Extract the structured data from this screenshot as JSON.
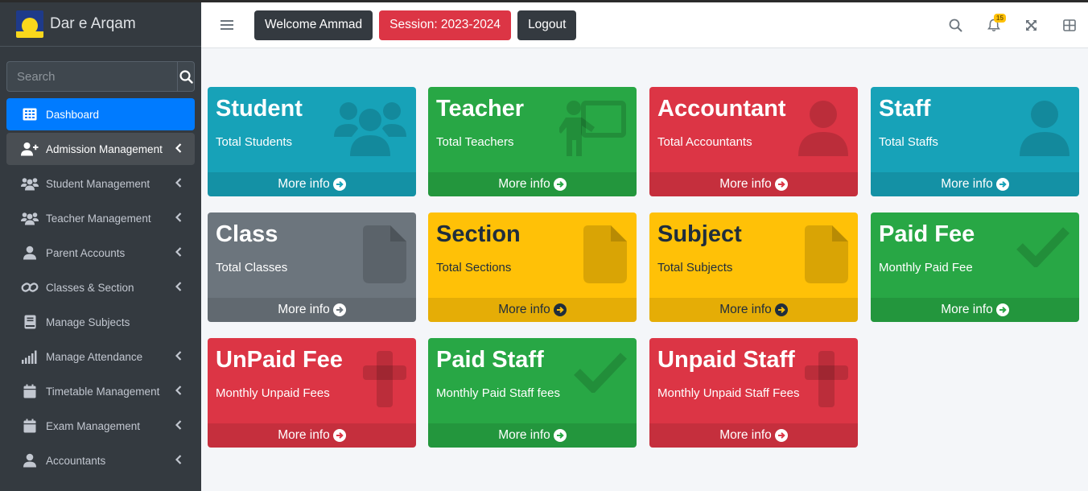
{
  "brand": {
    "name": "Dar e Arqam"
  },
  "search": {
    "placeholder": "Search"
  },
  "sidebar": {
    "items": [
      {
        "label": "Dashboard",
        "icon": "dashboard-grid-icon",
        "has_children": false,
        "state": "active"
      },
      {
        "label": "Admission Management",
        "icon": "user-plus-icon",
        "has_children": true,
        "state": "open"
      },
      {
        "label": "Student Management",
        "icon": "users-icon",
        "has_children": true,
        "state": ""
      },
      {
        "label": "Teacher Management",
        "icon": "users-icon",
        "has_children": true,
        "state": ""
      },
      {
        "label": "Parent Accounts",
        "icon": "user-icon",
        "has_children": true,
        "state": ""
      },
      {
        "label": "Classes & Section",
        "icon": "link-icon",
        "has_children": true,
        "state": ""
      },
      {
        "label": "Manage Subjects",
        "icon": "book-icon",
        "has_children": false,
        "state": ""
      },
      {
        "label": "Manage Attendance",
        "icon": "signal-bars-icon",
        "has_children": true,
        "state": ""
      },
      {
        "label": "Timetable Management",
        "icon": "calendar-icon",
        "has_children": true,
        "state": ""
      },
      {
        "label": "Exam Management",
        "icon": "calendar-icon",
        "has_children": true,
        "state": ""
      },
      {
        "label": "Accountants",
        "icon": "user-icon",
        "has_children": true,
        "state": ""
      }
    ]
  },
  "navbar": {
    "welcome": "Welcome Ammad",
    "session": "Session: 2023-2024",
    "logout": "Logout",
    "notification_count": "15"
  },
  "colors": {
    "teal": "#17a2b8",
    "green": "#28a745",
    "red": "#dc3545",
    "gray": "#6c757d",
    "yellow": "#ffc107",
    "primary": "#007bff",
    "sidebar": "#343a40"
  },
  "boxes": [
    {
      "title": "Student",
      "subtitle": "Total Students",
      "footer": "More info",
      "color": "teal",
      "icon": "users-icon"
    },
    {
      "title": "Teacher",
      "subtitle": "Total Teachers",
      "footer": "More info",
      "color": "green",
      "icon": "chalkboard-teacher-icon"
    },
    {
      "title": "Accountant",
      "subtitle": "Total Accountants",
      "footer": "More info",
      "color": "red",
      "icon": "user-icon"
    },
    {
      "title": "Staff",
      "subtitle": "Total Staffs",
      "footer": "More info",
      "color": "teal",
      "icon": "user-icon"
    },
    {
      "title": "Class",
      "subtitle": "Total Classes",
      "footer": "More info",
      "color": "gray",
      "icon": "file-icon"
    },
    {
      "title": "Section",
      "subtitle": "Total Sections",
      "footer": "More info",
      "color": "yellow",
      "icon": "file-icon"
    },
    {
      "title": "Subject",
      "subtitle": "Total Subjects",
      "footer": "More info",
      "color": "yellow",
      "icon": "file-icon"
    },
    {
      "title": "Paid Fee",
      "subtitle": "Monthly Paid Fee",
      "footer": "More info",
      "color": "green",
      "icon": "check-icon"
    },
    {
      "title": "UnPaid Fee",
      "subtitle": "Monthly Unpaid Fees",
      "footer": "More info",
      "color": "red",
      "icon": "cross-icon"
    },
    {
      "title": "Paid Staff",
      "subtitle": "Monthly Paid Staff fees",
      "footer": "More info",
      "color": "green",
      "icon": "check-icon"
    },
    {
      "title": "Unpaid Staff",
      "subtitle": "Monthly Unpaid Staff Fees",
      "footer": "More info",
      "color": "red",
      "icon": "cross-icon"
    }
  ]
}
